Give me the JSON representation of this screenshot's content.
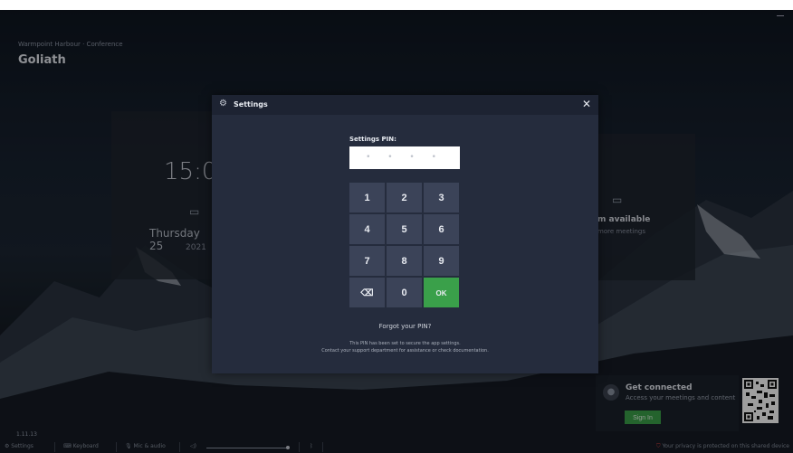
{
  "background": {
    "venue": "Warmpoint Harbour · Conference",
    "room": "Goliath",
    "clock": "15:0",
    "date": "Thursday 25",
    "year": "2021",
    "availability": "m available",
    "availability_sub": "more meetings"
  },
  "connect": {
    "title": "Get connected",
    "subtitle": "Access your meetings and content",
    "sign_in": "Sign In"
  },
  "version": "1.11.13",
  "bottom_bar": {
    "settings": "Settings",
    "keyboard": "Keyboard",
    "mic_audio": "Mic & audio",
    "privacy": "Your privacy is protected on this shared device"
  },
  "modal": {
    "title": "Settings",
    "pin_label": "Settings PIN:",
    "pin_mask": "• • • •",
    "keys": [
      "1",
      "2",
      "3",
      "4",
      "5",
      "6",
      "7",
      "8",
      "9",
      "⌫",
      "0",
      "OK"
    ],
    "forgot": "Forgot your PIN?",
    "help_line1": "This PIN has been set to secure the app settings.",
    "help_line2": "Contact your support department for assistance or check documentation."
  },
  "colors": {
    "accent_green": "#3aa04a",
    "modal_bg": "#252c3d",
    "key_bg": "#3b4358"
  },
  "icons": {
    "gear": "gear-icon",
    "close": "close-icon",
    "calendar": "calendar-icon",
    "backspace": "backspace-icon",
    "keyboard": "keyboard-icon",
    "mic": "mic-icon",
    "volume": "volume-icon",
    "bluetooth": "bluetooth-icon",
    "shield": "shield-icon"
  }
}
